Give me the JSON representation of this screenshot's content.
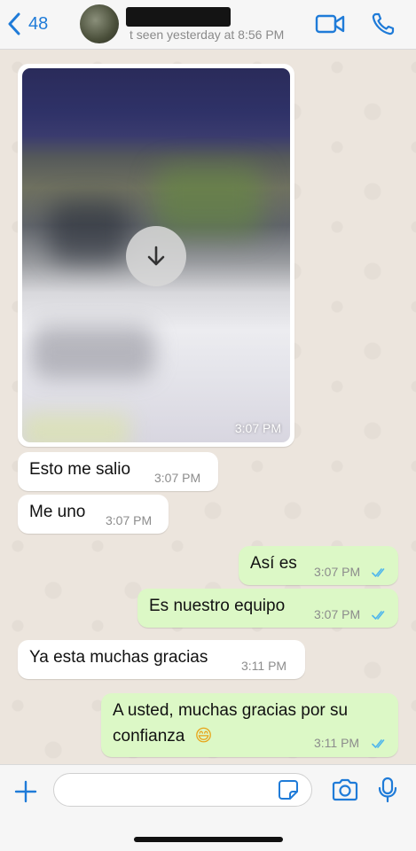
{
  "header": {
    "back_count": "48",
    "last_seen": "t seen yesterday at 8:56 PM"
  },
  "messages": [
    {
      "type": "image",
      "direction": "incoming",
      "time": "3:07 PM"
    },
    {
      "type": "text",
      "direction": "incoming",
      "text": "Esto me salio",
      "time": "3:07 PM"
    },
    {
      "type": "text",
      "direction": "incoming",
      "text": "Me uno",
      "time": "3:07 PM"
    },
    {
      "type": "text",
      "direction": "outgoing",
      "text": "Así es",
      "time": "3:07 PM",
      "status": "read"
    },
    {
      "type": "text",
      "direction": "outgoing",
      "text": "Es nuestro equipo",
      "time": "3:07 PM",
      "status": "read"
    },
    {
      "type": "text",
      "direction": "incoming",
      "text": "Ya esta muchas gracias",
      "time": "3:11 PM"
    },
    {
      "type": "text",
      "direction": "outgoing",
      "text_line1": "A usted, muchas gracias por su",
      "text_line2": "confianza",
      "emoji": "😄",
      "time": "3:11 PM",
      "status": "read"
    }
  ],
  "input": {
    "value": "",
    "placeholder": ""
  },
  "colors": {
    "accent": "#1f7bd8",
    "outgoing_bubble": "#dcf8c6",
    "incoming_bubble": "#ffffff",
    "chat_background": "#ece5dd",
    "read_ticks": "#4fb6ec"
  },
  "icons": {
    "back": "chevron-left-icon",
    "video": "video-camera-icon",
    "call": "phone-icon",
    "download": "arrow-down-icon",
    "attach": "plus-icon",
    "sticker": "sticker-icon",
    "camera": "camera-icon",
    "mic": "microphone-icon"
  }
}
